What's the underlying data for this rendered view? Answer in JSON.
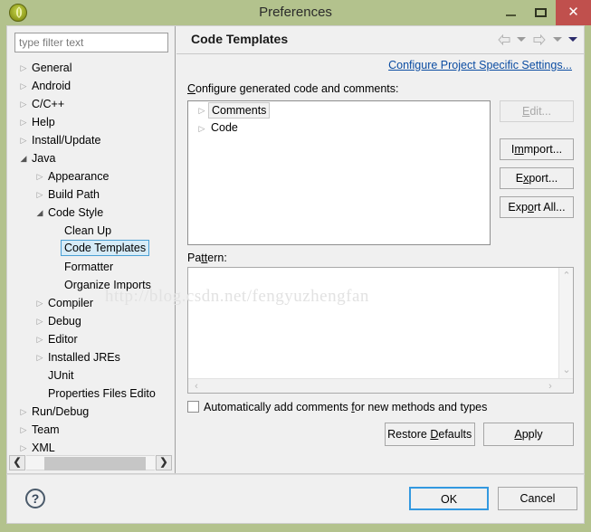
{
  "window": {
    "title": "Preferences",
    "icon": "()",
    "minimize_label": "Minimize",
    "maximize_label": "Maximize",
    "close_label": "✕"
  },
  "sidebar": {
    "filter_placeholder": "type filter text",
    "filter_value": "",
    "items": [
      {
        "label": "General",
        "indent": 0,
        "state": "collapsed"
      },
      {
        "label": "Android",
        "indent": 0,
        "state": "collapsed"
      },
      {
        "label": "C/C++",
        "indent": 0,
        "state": "collapsed"
      },
      {
        "label": "Help",
        "indent": 0,
        "state": "collapsed"
      },
      {
        "label": "Install/Update",
        "indent": 0,
        "state": "collapsed"
      },
      {
        "label": "Java",
        "indent": 0,
        "state": "expanded"
      },
      {
        "label": "Appearance",
        "indent": 1,
        "state": "collapsed"
      },
      {
        "label": "Build Path",
        "indent": 1,
        "state": "collapsed"
      },
      {
        "label": "Code Style",
        "indent": 1,
        "state": "expanded"
      },
      {
        "label": "Clean Up",
        "indent": 2,
        "state": "leaf"
      },
      {
        "label": "Code Templates",
        "indent": 2,
        "state": "leaf",
        "selected": true
      },
      {
        "label": "Formatter",
        "indent": 2,
        "state": "leaf"
      },
      {
        "label": "Organize Imports",
        "indent": 2,
        "state": "leaf"
      },
      {
        "label": "Compiler",
        "indent": 1,
        "state": "collapsed"
      },
      {
        "label": "Debug",
        "indent": 1,
        "state": "collapsed"
      },
      {
        "label": "Editor",
        "indent": 1,
        "state": "collapsed"
      },
      {
        "label": "Installed JREs",
        "indent": 1,
        "state": "collapsed"
      },
      {
        "label": "JUnit",
        "indent": 1,
        "state": "leaf"
      },
      {
        "label": "Properties Files Edito",
        "indent": 1,
        "state": "leaf"
      },
      {
        "label": "Run/Debug",
        "indent": 0,
        "state": "collapsed"
      },
      {
        "label": "Team",
        "indent": 0,
        "state": "collapsed"
      },
      {
        "label": "XML",
        "indent": 0,
        "state": "collapsed"
      }
    ],
    "scroll_left_label": "❮",
    "scroll_right_label": "❯"
  },
  "page": {
    "title": "Code Templates",
    "configure_link": "Configure Project Specific Settings...",
    "section_label_pre": "C",
    "section_label_post": "onfigure generated code and comments:",
    "templates": [
      {
        "label": "Comments",
        "state": "collapsed",
        "selected": true
      },
      {
        "label": "Code",
        "state": "collapsed",
        "selected": false
      }
    ],
    "buttons": {
      "edit": {
        "pre": "E",
        "mid": "dit...",
        "disabled": true
      },
      "import": {
        "pre": "I",
        "mid": "mport...",
        "disabled": false
      },
      "export": {
        "pre": "E",
        "mnem": "x",
        "mid": "port...",
        "disabled": false
      },
      "export_all": {
        "pre": "Exp",
        "mnem": "o",
        "mid": "rt All...",
        "disabled": false
      }
    },
    "pattern_label_pre": "Pa",
    "pattern_label_mnem": "tt",
    "pattern_label_post": "ern:",
    "pattern_value": "",
    "checkbox": {
      "checked": false,
      "text_pre": "Automatically add comments ",
      "text_mnem": "f",
      "text_post": "or new methods and types"
    },
    "restore_defaults": {
      "pre": "Restore ",
      "mnem": "D",
      "post": "efaults"
    },
    "apply": {
      "pre": "",
      "mnem": "A",
      "post": "pply"
    }
  },
  "footer": {
    "help_label": "?",
    "ok_label": "OK",
    "cancel_label": "Cancel"
  },
  "watermark": "http://blog.csdn.net/fengyuzhengfan",
  "colors": {
    "titlebar": "#b3c28d",
    "close_button": "#c0504d",
    "dialog_bg": "#f0f0f0",
    "link": "#0c4da2",
    "selection_fill": "#d6ebf7",
    "selection_border": "#4a9fd4",
    "focus_border": "#3399e0"
  }
}
